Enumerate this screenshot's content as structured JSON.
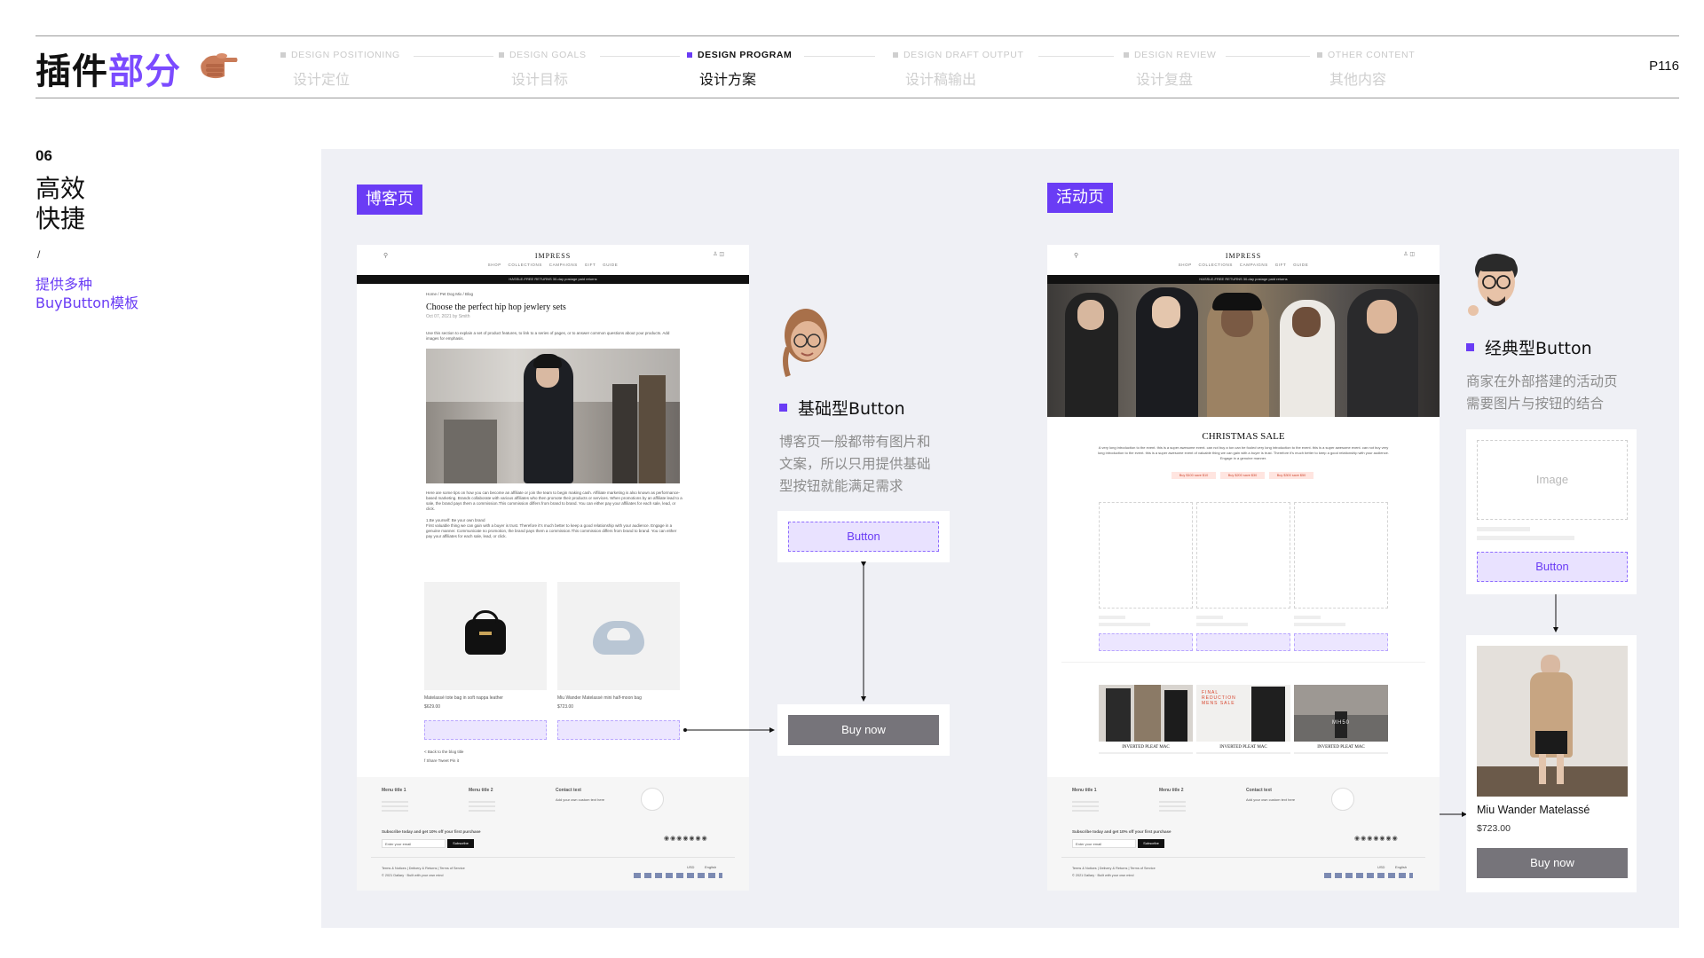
{
  "header": {
    "title_black": "插件",
    "title_accent": "部分",
    "page_number": "P116",
    "steps": [
      {
        "en": "DESIGN POSITIONING",
        "zh": "设计定位",
        "active": false
      },
      {
        "en": "DESIGN GOALS",
        "zh": "设计目标",
        "active": false
      },
      {
        "en": "DESIGN PROGRAM",
        "zh": "设计方案",
        "active": true
      },
      {
        "en": "DESIGN DRAFT OUTPUT",
        "zh": "设计稿输出",
        "active": false
      },
      {
        "en": "DESIGN REVIEW",
        "zh": "设计复盘",
        "active": false
      },
      {
        "en": "OTHER CONTENT",
        "zh": "其他内容",
        "active": false
      }
    ]
  },
  "section": {
    "number": "06",
    "title_line1": "高效",
    "title_line2": "快捷",
    "slash": "/",
    "subtitle_line1": "提供多种",
    "subtitle_line2": "BuyButton模板"
  },
  "blog": {
    "tag": "博客页",
    "brand": "IMPRESS",
    "nav": "SHOP COLLECTIONS CAMPAIGNS GIFT GUIDE",
    "announcement": "HASSLE-FREE RETURNS  30-day postage paid returns",
    "breadcrumb": "Home  /  Pet Dog Mix  /  Blog",
    "post_title": "Choose the perfect hip hop jewlery sets",
    "post_meta": "Oct 07, 2021  by Smith",
    "intro": "Use this section to explain a set of product features, to link to a series of pages, or to answer common questions about your products. Add images for emphasis.",
    "body1": "Here are some tips on how you can become an affiliate or join the team to begin making cash. Affiliate marketing is also known as performance-based marketing. Brands collaborate with various affiliates who then promote their products or services. When promotions by an affiliate lead to a sale, the brand pays them a commission.This commission differs from brand to brand. You can either pay your affiliates for each sale, lead, or click.",
    "body2_head": "1.Be yourself:  Be your own brand",
    "body2": "First valuable thing we can gain with a buyer is trust. Therefore it's much better to keep a good relationship with your audience. Engage in a genuine manner. Communicate no promotion, the brand pays them a commission.This commission differs from brand to brand. You can either pay your affiliates for each sale, lead, or click.",
    "products": [
      {
        "name": "Matelassé tote bag in soft nappa leather",
        "price": "$629.00"
      },
      {
        "name": "Miu Wander Matelassé mini half-moon bag",
        "price": "$723.00"
      }
    ],
    "back_link": "< Back to the blog title",
    "share": "f Share   Tweet   Pin it",
    "footer": {
      "cols": [
        "Menu title 1",
        "Menu title 2",
        "Contact text"
      ],
      "contact": "Add your own custom text here",
      "subscribe": "Subscribe today and get 10% off your first purchase",
      "email_placeholder": "Enter your email",
      "subscribe_btn": "Subscribe",
      "legal": "Terms & Notices  |  Delivery & Returns  |  Terms of Service",
      "copyright": "© 2021 Dallary · Built with your own mind",
      "currency": "USD",
      "lang": "English"
    }
  },
  "basic_button": {
    "title": "基础型Button",
    "desc_line1": "博客页一般都带有图片和",
    "desc_line2": "文案，所以只用提供基础",
    "desc_line3": "型按钮就能满足需求",
    "button_label": "Button",
    "buy_label": "Buy now"
  },
  "event": {
    "tag": "活动页",
    "brand": "IMPRESS",
    "nav": "SHOP COLLECTIONS CAMPAIGNS GIFT GUIDE",
    "announcement": "HASSLE-FREE RETURNS  30-day postage paid returns",
    "sale_title": "CHRISTMAS SALE",
    "sale_text": "A very long introduction to the event. this is a super awesome event. can not buy a ton can be fooled very long introduction to the event. this is a super awesome event. can not buy very long introduction to the event. this is a super awesome event of valuable thing we can gain with a buyer is trust. Therefore it's much better to keep a good relationship with your audience. Engage in a genuine manner.",
    "chips": [
      "Buy $100 save $10",
      "Buy $200 save $30",
      "Buy $300 save $50"
    ],
    "cards": [
      {
        "caption": "INVERTED PLEAT MAC"
      },
      {
        "caption": "INVERTED PLEAT MAC",
        "overlay": "FINAL REDUCTION MENS SALE"
      },
      {
        "caption": "INVERTED PLEAT MAC",
        "overlay": "MH50"
      }
    ]
  },
  "classic_button": {
    "title": "经典型Button",
    "desc_line1": "商家在外部搭建的活动页",
    "desc_line2": "需要图片与按钮的结合",
    "image_label": "Image",
    "button_label": "Button",
    "product_name": "Miu Wander Matelassé",
    "product_price": "$723.00",
    "buy_label": "Buy now"
  },
  "colors": {
    "accent": "#6a3cf5",
    "panel": "#eff0f5",
    "gray_button": "#76747a"
  }
}
